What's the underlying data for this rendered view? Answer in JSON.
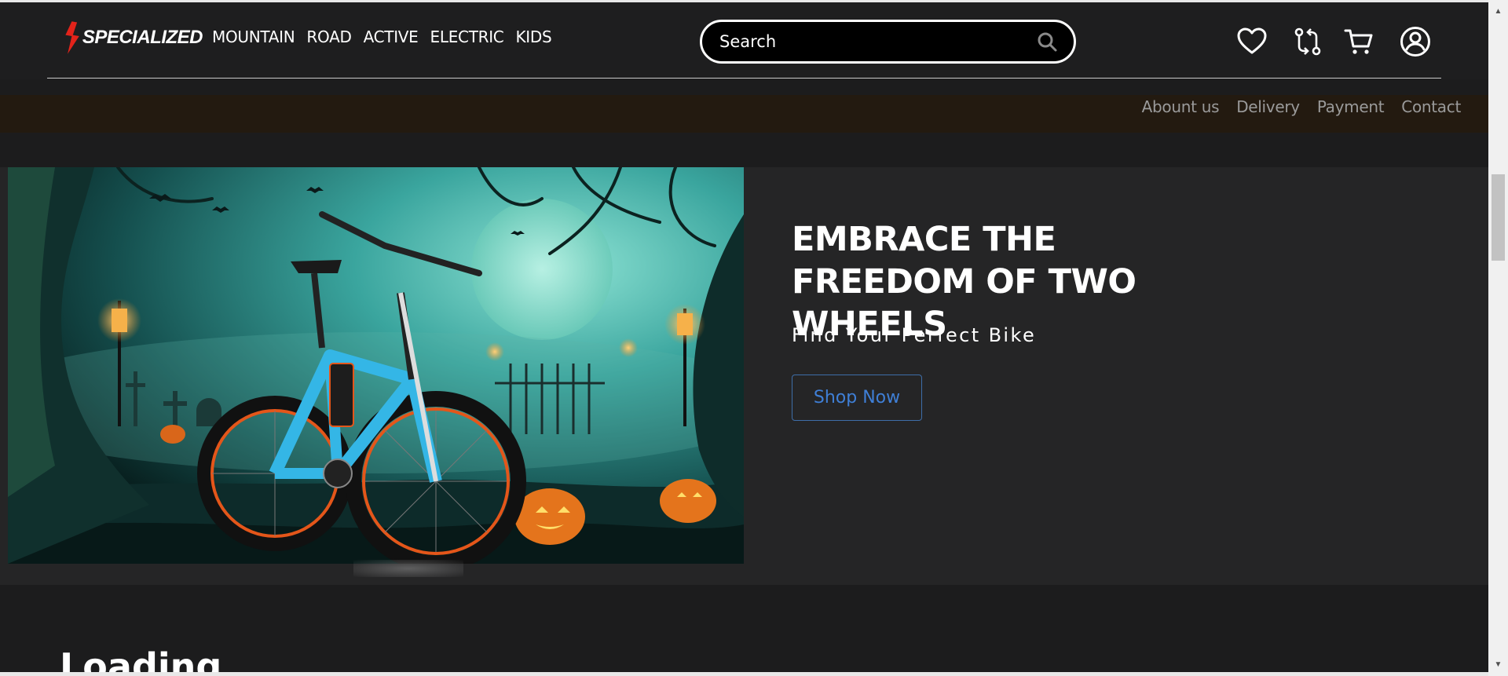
{
  "header": {
    "logo_text": "SPECIALIZED",
    "nav": [
      "MOUNTAIN",
      "ROAD",
      "ACTIVE",
      "ELECTRIC",
      "KIDS"
    ],
    "search_placeholder": "Search",
    "icons": [
      "heart-icon",
      "compare-icon",
      "cart-icon",
      "account-icon"
    ]
  },
  "subnav": [
    "Abount us",
    "Delivery",
    "Payment",
    "Contact"
  ],
  "hero": {
    "title": "EMBRACE THE FREEDOM OF TWO WHEELS",
    "subtitle": "Find Your Perfect Bike",
    "cta": "Shop Now"
  },
  "section": {
    "heading": "Loading"
  },
  "colors": {
    "background": "#1c1c1d",
    "header": "#1e1e1f",
    "subnav": "#231a10",
    "hero": "#252526",
    "accent_red": "#e2231a",
    "link_blue": "#3f7fd6"
  }
}
